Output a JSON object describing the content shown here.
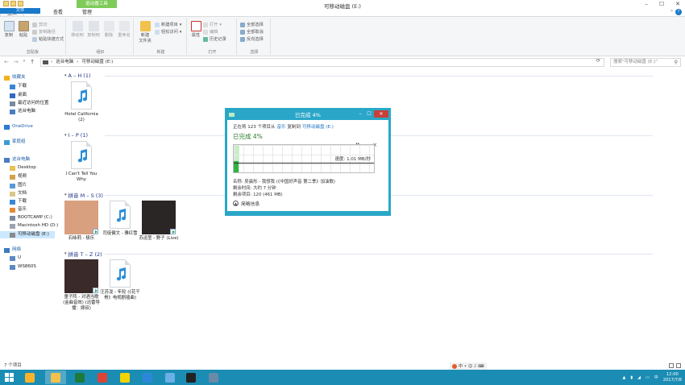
{
  "window": {
    "title": "可移动磁盘 (E:)",
    "context_tab": "驱动器工具"
  },
  "ribbon": {
    "tabs": [
      "文件",
      "主页",
      "共享",
      "查看",
      "管理"
    ],
    "groups": {
      "clipboard": {
        "label": "剪贴板",
        "copy": "复制",
        "paste": "粘贴",
        "cut": "剪切",
        "copy_path": "复制路径",
        "paste_shortcut": "粘贴快捷方式"
      },
      "organize": {
        "label": "组织",
        "move_to": "移动到",
        "copy_to": "复制到",
        "delete": "删除",
        "rename": "重命名"
      },
      "new": {
        "label": "新建",
        "new_folder": "新建\n文件夹",
        "new_item": "新建项目",
        "easy_access": "轻松访问"
      },
      "open": {
        "label": "打开",
        "properties": "属性",
        "open": "打开",
        "edit": "编辑",
        "history": "历史记录"
      },
      "select": {
        "label": "选择",
        "select_all": "全部选择",
        "select_none": "全部取消",
        "invert": "反向选择"
      }
    }
  },
  "address": {
    "path": [
      "这台电脑",
      "可移动磁盘 (E:)"
    ],
    "search_placeholder": "搜索\"可移动磁盘 (E:)\""
  },
  "sidebar": {
    "items": [
      {
        "label": "收藏夹",
        "color": "#f2b01e",
        "top": true
      },
      {
        "label": "下载",
        "color": "#3a86d6"
      },
      {
        "label": "桌面",
        "color": "#2f6ac2"
      },
      {
        "label": "最近访问的位置",
        "color": "#7a8aa0"
      },
      {
        "label": "这台电脑",
        "color": "#4a7cc2"
      },
      {
        "label": "OneDrive",
        "color": "#2b7bd6",
        "top": true
      },
      {
        "label": "家庭组",
        "color": "#3b9bd6",
        "top": true
      },
      {
        "label": "这台电脑",
        "color": "#4a7cc2",
        "top": true
      },
      {
        "label": "Desktop",
        "color": "#e8c152"
      },
      {
        "label": "视频",
        "color": "#d0a34a"
      },
      {
        "label": "图片",
        "color": "#5a9ad6"
      },
      {
        "label": "文档",
        "color": "#d8c78a"
      },
      {
        "label": "下载",
        "color": "#3a86d6"
      },
      {
        "label": "音乐",
        "color": "#e28a3a"
      },
      {
        "label": "BOOTCAMP (C:)",
        "color": "#7a8aa0"
      },
      {
        "label": "Macintosh HD (D:)",
        "color": "#9aa4b0"
      },
      {
        "label": "可移动磁盘 (E:)",
        "color": "#8a8a8a",
        "selected": true
      },
      {
        "label": "网络",
        "color": "#3b7bc2",
        "top": true
      },
      {
        "label": "U",
        "color": "#5a8ac2"
      },
      {
        "label": "WS860S",
        "color": "#5a8ac2"
      }
    ]
  },
  "groups": [
    {
      "header": "A – H (1)",
      "files": [
        {
          "name": "Hotel California (2)",
          "kind": "audio"
        }
      ]
    },
    {
      "header": "I – P (1)",
      "files": [
        {
          "name": "I Can't Tell You Why",
          "kind": "audio"
        }
      ]
    },
    {
      "header": "拼音 M – S (3)",
      "files": [
        {
          "name": "石咏莉 - 极乐",
          "kind": "album",
          "art": "#d9a080"
        },
        {
          "name": "司徒健文 - 雅红雪",
          "kind": "audio"
        },
        {
          "name": "苏运莹 - 野子 (Live)",
          "kind": "album",
          "art": "#2a2626"
        }
      ]
    },
    {
      "header": "拼音 T – Z (2)",
      "files": [
        {
          "name": "童子阵 - 对酒当歌 (金曲音效) (迅雷导播：嫁叔)",
          "kind": "album",
          "art": "#3a2a2a"
        },
        {
          "name": "汪苏泷 - 年轮 (《花千骨》电视剧插曲)",
          "kind": "audio"
        }
      ]
    }
  ],
  "status": {
    "count": "7 个项目"
  },
  "dialog": {
    "title": "已完成 4%",
    "line_prefix": "正在将 123 个项目从",
    "from": "音乐",
    "line_mid": "复制到",
    "to": "可移动磁盘 (E:)",
    "progress_label": "已完成 4%",
    "progress": 0.04,
    "speed": "速度: 1.01 MB/秒",
    "name_line": "名称: 吴晨彤 - 我想我 (《中国好声音 第二季》加油歌)",
    "time_line": "剩余时间: 大约 7 分钟",
    "items_line": "剩余项目: 120 (461 MB)",
    "less": "简略信息",
    "pause": "II",
    "cancel": "×"
  },
  "taskbar": {
    "apps": [
      {
        "name": "ie",
        "color": "#f7b32b"
      },
      {
        "name": "explorer",
        "color": "#f2c14e",
        "active": true
      },
      {
        "name": "excel",
        "color": "#1e7a3a"
      },
      {
        "name": "chrome",
        "color": "#db4437"
      },
      {
        "name": "fruit",
        "color": "#f2d400"
      },
      {
        "name": "qq-browser",
        "color": "#2b88d8"
      },
      {
        "name": "swift",
        "color": "#6ab0e6"
      },
      {
        "name": "media",
        "color": "#222"
      },
      {
        "name": "settings",
        "color": "#6a8aa8"
      }
    ],
    "time": "12:00",
    "date": "2017/7/8"
  }
}
